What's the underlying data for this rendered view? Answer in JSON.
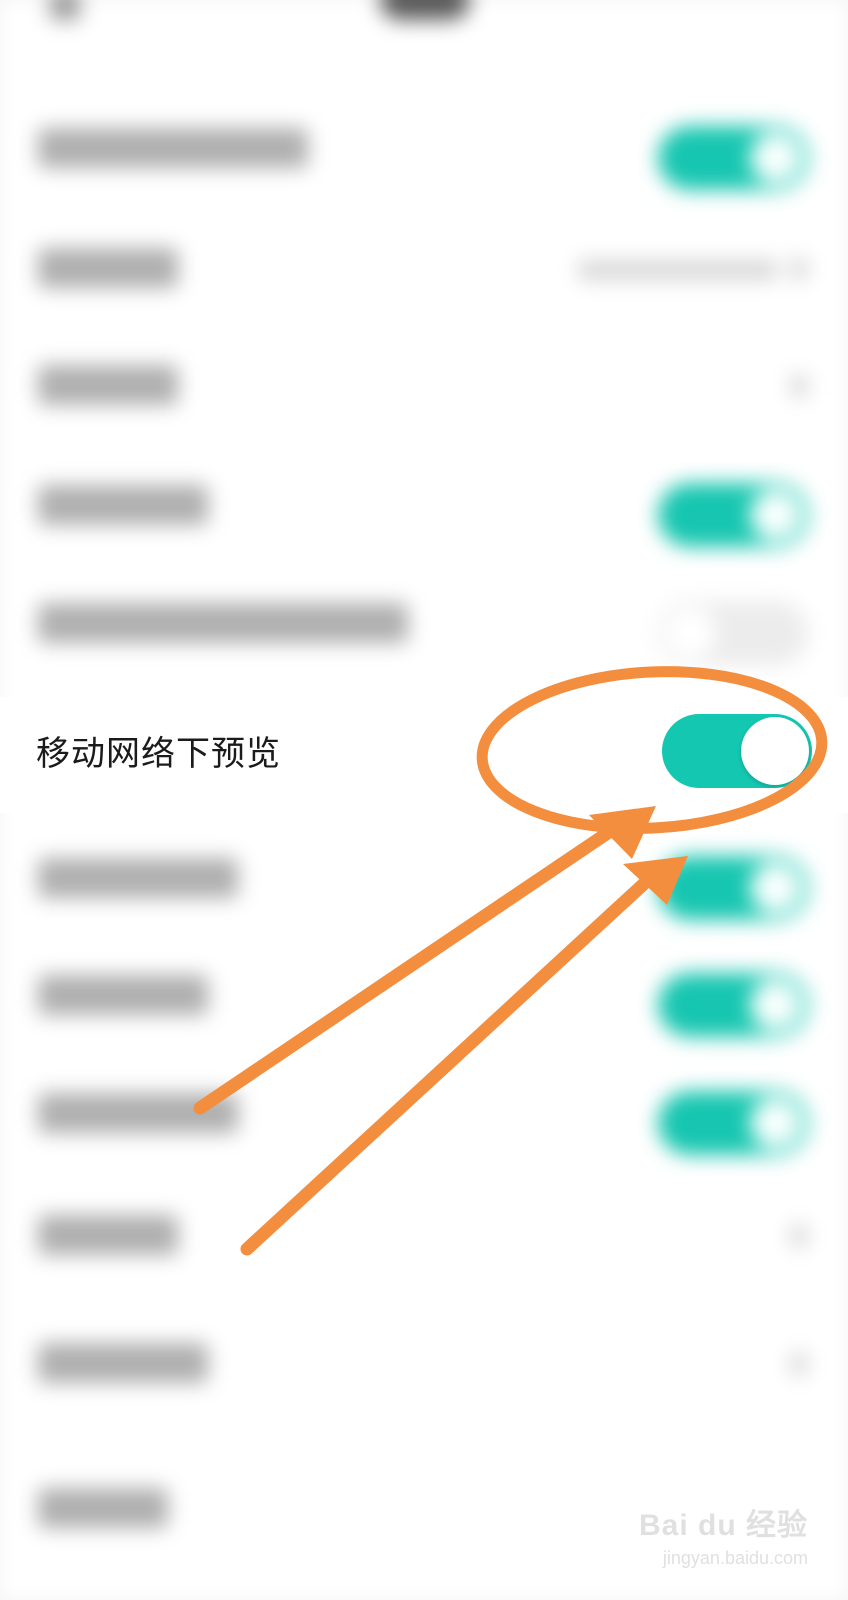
{
  "setting_row": {
    "label": "移动网络下预览",
    "toggle_on": true,
    "accent_color": "#14c7b1"
  },
  "annotation": {
    "color": "#f38e3f",
    "shapes": [
      "ellipse",
      "arrow",
      "arrow"
    ]
  },
  "watermark": {
    "logo": "Bai du 经验",
    "url": "jingyan.baidu.com"
  }
}
